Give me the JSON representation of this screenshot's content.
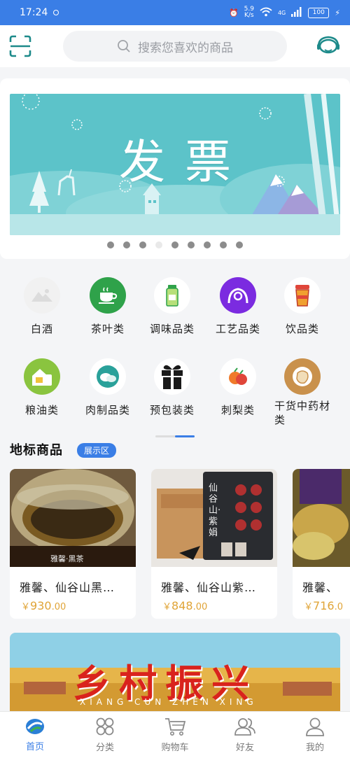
{
  "status_bar": {
    "time": "17:24",
    "net_speed": "5.9",
    "net_unit": "K/s",
    "signal": "4G",
    "battery": "100"
  },
  "header": {
    "search_placeholder": "搜索您喜欢的商品",
    "scan_icon": "scan-icon",
    "service_icon": "customer-service-icon"
  },
  "banner": {
    "title": "发票",
    "dots_count": 9,
    "active_index": 3
  },
  "categories": [
    {
      "label": "白酒",
      "icon": "liquor-icon",
      "color": "#f1f1f1"
    },
    {
      "label": "茶叶类",
      "icon": "tea-cup-icon",
      "color": "#2fa24a"
    },
    {
      "label": "调味品类",
      "icon": "seasoning-bottle-icon",
      "color": "#ffffff"
    },
    {
      "label": "工艺品类",
      "icon": "crafts-icon",
      "color": "#7b2be0"
    },
    {
      "label": "饮品类",
      "icon": "drink-cup-icon",
      "color": "#ffffff"
    },
    {
      "label": "粮油类",
      "icon": "grain-oil-icon",
      "color": "#8ac43f"
    },
    {
      "label": "肉制品类",
      "icon": "meat-icon",
      "color": "#ffffff"
    },
    {
      "label": "预包装类",
      "icon": "gift-box-icon",
      "color": "#ffffff"
    },
    {
      "label": "刺梨类",
      "icon": "fruit-icon",
      "color": "#ffffff"
    },
    {
      "label": "干货中药材类",
      "icon": "herb-icon",
      "color": "#c9914c"
    }
  ],
  "landmark": {
    "title": "地标商品",
    "badge": "展示区",
    "products": [
      {
        "name": "雅馨、仙谷山黑…",
        "currency": "￥",
        "price_int": "930",
        "price_dec": ".00",
        "image_caption": "雅馨·黑茶"
      },
      {
        "name": "雅馨、仙谷山紫…",
        "currency": "￥",
        "price_int": "848",
        "price_dec": ".00",
        "image_caption": "仙谷山·紫娟"
      },
      {
        "name": "雅馨、",
        "currency": "￥",
        "price_int": "716",
        "price_dec": ".0",
        "image_caption": ""
      }
    ]
  },
  "rural_banner": {
    "title": "乡村振兴",
    "subtitle": "XIANG CUN ZHEN XING"
  },
  "tabs": [
    {
      "label": "首页",
      "icon": "home-logo-icon",
      "active": true
    },
    {
      "label": "分类",
      "icon": "category-icon",
      "active": false
    },
    {
      "label": "购物车",
      "icon": "cart-icon",
      "active": false
    },
    {
      "label": "好友",
      "icon": "friends-icon",
      "active": false
    },
    {
      "label": "我的",
      "icon": "profile-icon",
      "active": false
    }
  ],
  "colors": {
    "accent": "#3a7ee6",
    "price": "#e0a437",
    "banner_bg": "#5cc3c9"
  }
}
